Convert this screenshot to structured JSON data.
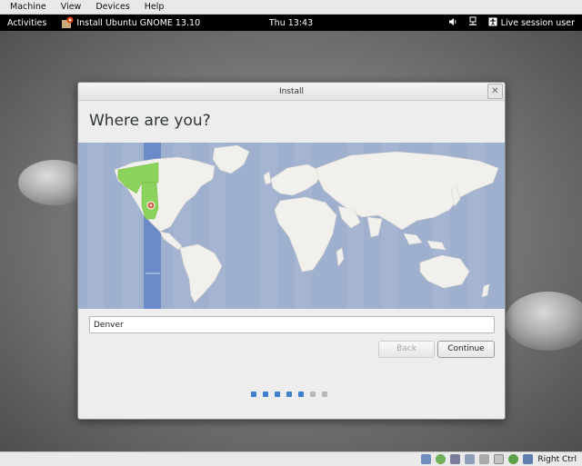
{
  "vbox_menu": [
    "Machine",
    "View",
    "Devices",
    "Help"
  ],
  "top_bar": {
    "activities": "Activities",
    "app_name": "Install Ubuntu GNOME 13.10",
    "clock": "Thu 13:43",
    "user": "Live session user"
  },
  "window": {
    "title": "Install",
    "heading": "Where are you?",
    "close_glyph": "✕"
  },
  "timezone": {
    "value": "Denver",
    "selected_marker": "location-pin-icon"
  },
  "buttons": {
    "back": "Back",
    "continue": "Continue"
  },
  "progress": {
    "total": 7,
    "completed": 5
  },
  "status_bar": {
    "host_key": "Right Ctrl",
    "icons": [
      "hard-disk-icon",
      "optical-drive-icon",
      "usb-icon",
      "shared-folders-icon",
      "display-icon",
      "video-capture-icon",
      "network-icon",
      "mouse-integration-icon"
    ]
  },
  "colors": {
    "map_ocean": "#9fb0cf",
    "map_land": "#f2f0ec",
    "timezone_highlight": "#5a7fc5",
    "selected_region": "#8bd35c",
    "progress_done": "#3f7fd1",
    "progress_todo": "#b8b8b8"
  }
}
